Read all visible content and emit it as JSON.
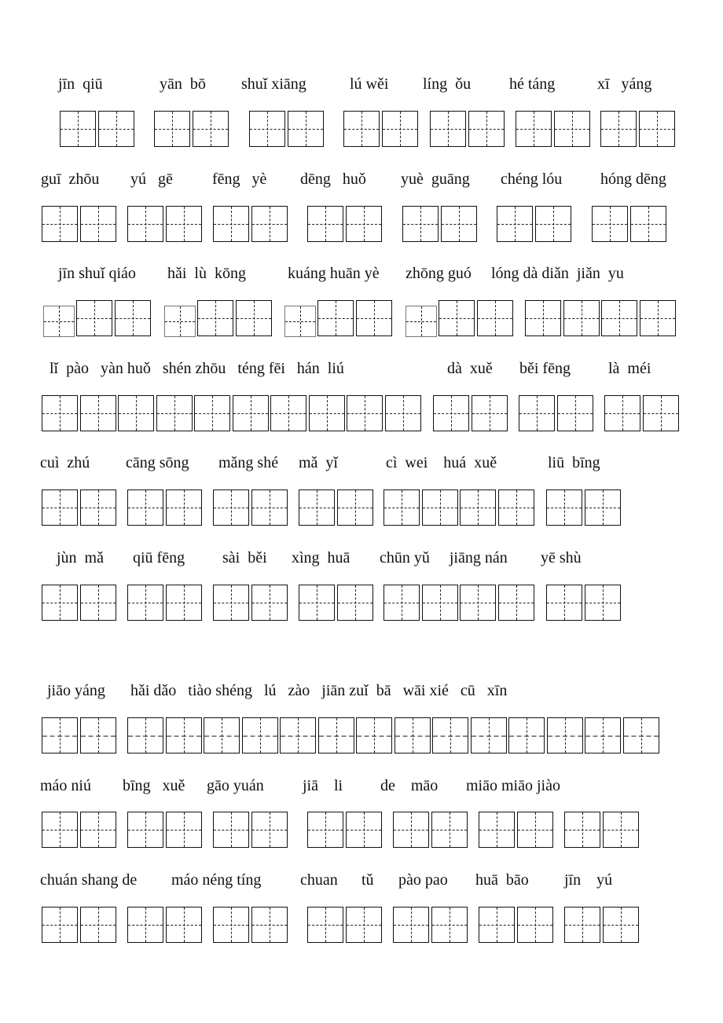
{
  "worksheet": {
    "rows": [
      {
        "words": [
          {
            "pinyin": "jīn  qiū",
            "chars": 2
          },
          {
            "pinyin": "yān  bō",
            "chars": 2
          },
          {
            "pinyin": "shuǐ xiāng",
            "chars": 2
          },
          {
            "pinyin": "lú wěi",
            "chars": 2
          },
          {
            "pinyin": "líng  ǒu",
            "chars": 2
          },
          {
            "pinyin": "hé táng",
            "chars": 2
          },
          {
            "pinyin": "xī   yáng",
            "chars": 2
          }
        ]
      },
      {
        "words": [
          {
            "pinyin": "guī  zhōu",
            "chars": 2
          },
          {
            "pinyin": "yú   gē",
            "chars": 2
          },
          {
            "pinyin": "fēng   yè",
            "chars": 2
          },
          {
            "pinyin": "dēng   huǒ",
            "chars": 2
          },
          {
            "pinyin": "yuè  guāng",
            "chars": 2
          },
          {
            "pinyin": "chéng lóu",
            "chars": 2
          },
          {
            "pinyin": "hóng dēng",
            "chars": 2
          }
        ]
      },
      {
        "words": [
          {
            "pinyin": "jīn shuǐ qiáo",
            "chars": 3
          },
          {
            "pinyin": "hǎi  lù  kōng",
            "chars": 3
          },
          {
            "pinyin": "kuáng huān yè",
            "chars": 3
          },
          {
            "pinyin": "zhōng guó",
            "chars": 3
          },
          {
            "pinyin": "lóng dà diǎn  jiǎn  yu",
            "chars": 4
          }
        ]
      },
      {
        "words": [
          {
            "pinyin": "lǐ  pào   yàn huǒ   shén zhōu   téng fēi   hán  liú",
            "chars": 10
          },
          {
            "pinyin": "dà  xuě",
            "chars": 2
          },
          {
            "pinyin": "běi fēng",
            "chars": 2
          },
          {
            "pinyin": "là  méi",
            "chars": 2
          }
        ]
      },
      {
        "words": [
          {
            "pinyin": "cuì  zhú",
            "chars": 2
          },
          {
            "pinyin": "cāng sōng",
            "chars": 2
          },
          {
            "pinyin": "mǎng shé",
            "chars": 2
          },
          {
            "pinyin": "mǎ  yǐ",
            "chars": 2
          },
          {
            "pinyin": "cì  wei    huá  xuě",
            "chars": 4
          },
          {
            "pinyin": "liū  bīng",
            "chars": 2
          }
        ]
      },
      {
        "words": [
          {
            "pinyin": "jùn  mǎ",
            "chars": 2
          },
          {
            "pinyin": "qiū fēng",
            "chars": 2
          },
          {
            "pinyin": "sài  běi",
            "chars": 2
          },
          {
            "pinyin": "xìng  huā",
            "chars": 2
          },
          {
            "pinyin": "chūn yǔ     jiāng nán",
            "chars": 4
          },
          {
            "pinyin": "yē shù",
            "chars": 2
          }
        ]
      },
      {
        "words": [
          {
            "pinyin": "jiāo yáng",
            "chars": 2
          },
          {
            "pinyin": "hǎi dǎo   tiào shéng   lú   zào   jiān zuǐ  bā   wāi xié   cū   xīn",
            "chars": 14
          }
        ]
      },
      {
        "words": [
          {
            "pinyin": "máo niú",
            "chars": 2
          },
          {
            "pinyin": "bīng   xuě",
            "chars": 2
          },
          {
            "pinyin": "gāo yuán",
            "chars": 2
          },
          {
            "pinyin": "jiā    li",
            "chars": 2
          },
          {
            "pinyin": "de    māo",
            "chars": 2
          },
          {
            "pinyin": "miāo miāo jiào",
            "chars": 2
          },
          {
            "pinyin": "",
            "chars": 2
          }
        ]
      },
      {
        "words": [
          {
            "pinyin": "chuán shang de",
            "chars": 2
          },
          {
            "pinyin": "máo néng tíng",
            "chars": 2
          },
          {
            "pinyin": "chuan",
            "chars": 2
          },
          {
            "pinyin": "tǔ",
            "chars": 2
          },
          {
            "pinyin": "pào pao",
            "chars": 2
          },
          {
            "pinyin": "huā  bāo",
            "chars": 2
          },
          {
            "pinyin": "jīn    yú",
            "chars": 2
          }
        ]
      }
    ]
  }
}
